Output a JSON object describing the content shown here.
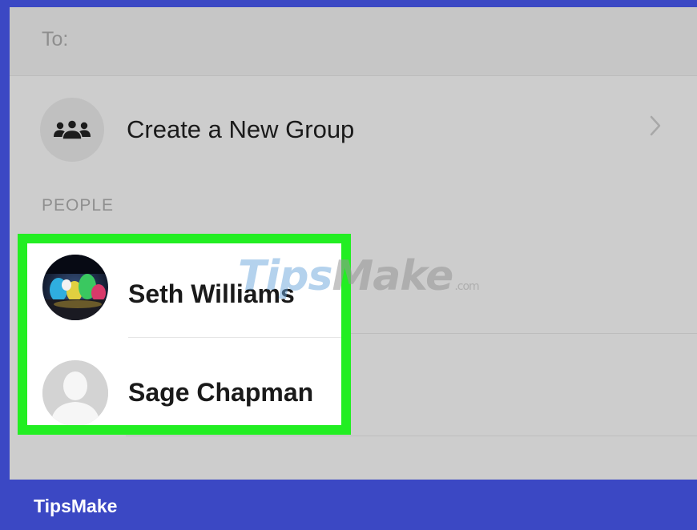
{
  "to_field": {
    "label": "To:"
  },
  "create_group": {
    "label": "Create a New Group",
    "icon": "group-icon"
  },
  "people_section": {
    "label": "PEOPLE"
  },
  "contacts": [
    {
      "name": "Seth Williams",
      "avatar": "photo-avatar"
    },
    {
      "name": "Sage Chapman",
      "avatar": "default-avatar"
    }
  ],
  "watermark": {
    "tips": "Tips",
    "make": "Make",
    "suffix": ".com"
  },
  "branding": {
    "label": "TipsMake"
  },
  "colors": {
    "frame": "#3b48c4",
    "highlight": "#22ee22",
    "screen_bg": "#cdcdcd"
  }
}
